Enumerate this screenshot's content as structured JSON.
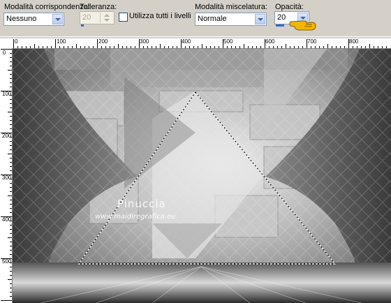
{
  "toolbar": {
    "match_mode": {
      "label": "Modalità corrispondenza:",
      "value": "Nessuno"
    },
    "tolerance": {
      "label": "Tolleranza:",
      "value": "20"
    },
    "all_layers": {
      "label": "Utilizza tutti i livelli",
      "checked": false
    },
    "blend_mode": {
      "label": "Modalità miscelatura:",
      "value": "Normale"
    },
    "opacity": {
      "label": "Opacità:",
      "value": "20"
    }
  },
  "ruler": {
    "top_labels": [
      "0",
      "100",
      "200",
      "300",
      "400",
      "500",
      "600",
      "700",
      "800"
    ],
    "left_labels": [
      "0",
      "100",
      "200",
      "300",
      "400",
      "500"
    ]
  },
  "watermark": {
    "name": "Pinuccia",
    "site": "www.maidiregrafica.eu"
  },
  "colors": {
    "accent": "#316ac5",
    "cursor_hand": "#f2b705"
  }
}
